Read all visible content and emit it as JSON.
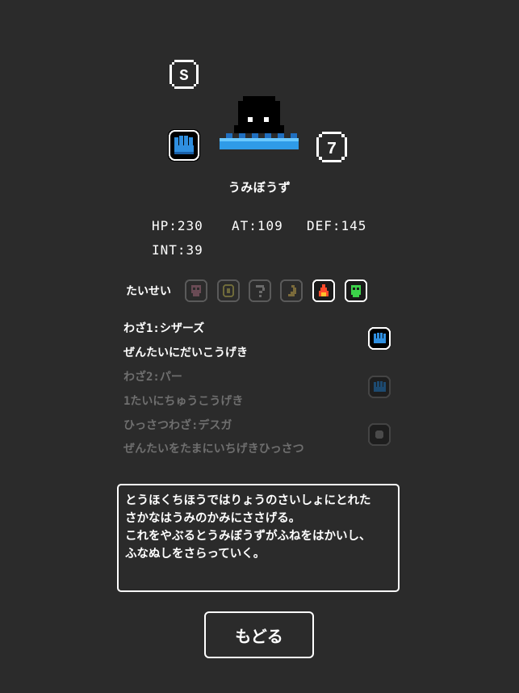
{
  "header": {
    "rank": "S",
    "level": "7"
  },
  "monster": {
    "name": "うみぼうず"
  },
  "stats": {
    "hp": "HP:230",
    "at": "AT:109",
    "def": "DEF:145",
    "int": "INT:39"
  },
  "resistance": {
    "label": "たいせい",
    "icons": [
      {
        "name": "skull-icon",
        "active": false
      },
      {
        "name": "paralysis-icon",
        "active": false
      },
      {
        "name": "confusion-icon",
        "active": false
      },
      {
        "name": "sleep-moon-icon",
        "active": false
      },
      {
        "name": "fire-icon",
        "active": true
      },
      {
        "name": "poison-icon",
        "active": true
      }
    ]
  },
  "skills": {
    "skill1_name": "わざ1:シザーズ",
    "skill1_desc": "ぜんたいにだいこうげき",
    "skill2_name": "わざ2:パー",
    "skill2_desc": "1たいにちゅうこうげき",
    "special_name": "ひっさつわざ:デスガ",
    "special_desc": "ぜんたいをたまにいちげきひっさつ"
  },
  "description": "とうほくちほうではりょうのさいしょにとれた\nさかなはうみのかみにささげる。\nこれをやぶるとうみぼうずがふねをはかいし、\nふなぬしをさらっていく。",
  "buttons": {
    "back": "もどる"
  },
  "colors": {
    "background": "#2b2b2b",
    "accent_blue": "#2f8fe0",
    "water_light": "#6ac8ff",
    "dim": "#6f6f6f"
  }
}
